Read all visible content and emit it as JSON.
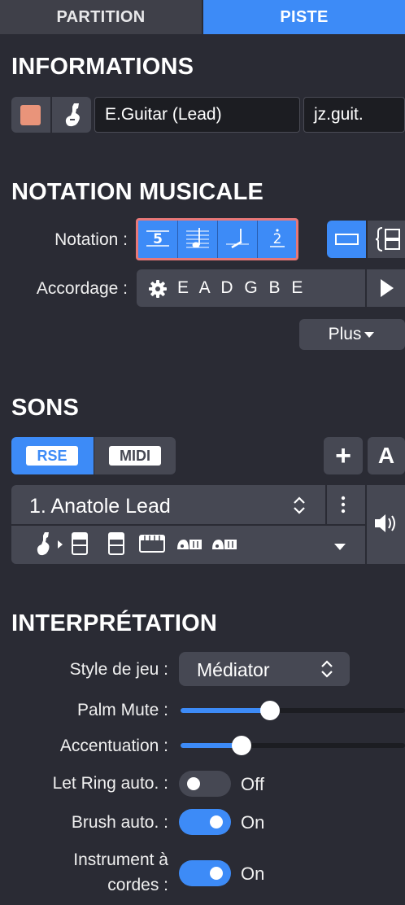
{
  "tabs": {
    "partition": "PARTITION",
    "piste": "PISTE"
  },
  "informations": {
    "title": "INFORMATIONS",
    "track_color": "#e9947a",
    "track_name": "E.Guitar (Lead)",
    "short_name": "jz.guit."
  },
  "notation": {
    "title": "NOTATION MUSICALE",
    "notation_label": "Notation :",
    "tab_number": "5",
    "slash_number": "2",
    "accordage_label": "Accordage :",
    "tuning": "E A D G B E",
    "plus_label": "Plus"
  },
  "sons": {
    "title": "SONS",
    "rse_label": "RSE",
    "midi_label": "MIDI",
    "add_label": "+",
    "a_label": "A",
    "preset": "1. Anatole Lead"
  },
  "interpretation": {
    "title": "INTERPRÉTATION",
    "style_label": "Style de jeu :",
    "style_value": "Médiator",
    "palm_mute_label": "Palm Mute :",
    "palm_mute_level": 0.4,
    "accentuation_label": "Accentuation :",
    "accentuation_level": 0.27,
    "let_ring_label": "Let Ring auto. :",
    "let_ring_value": "Off",
    "brush_label": "Brush auto. :",
    "brush_value": "On",
    "strings_label_line1": "Instrument à",
    "strings_label_line2": "cordes :",
    "strings_value": "On"
  },
  "colors": {
    "accent": "#3d8bf7",
    "highlight_border": "#e87878",
    "background": "#2a2b34"
  }
}
